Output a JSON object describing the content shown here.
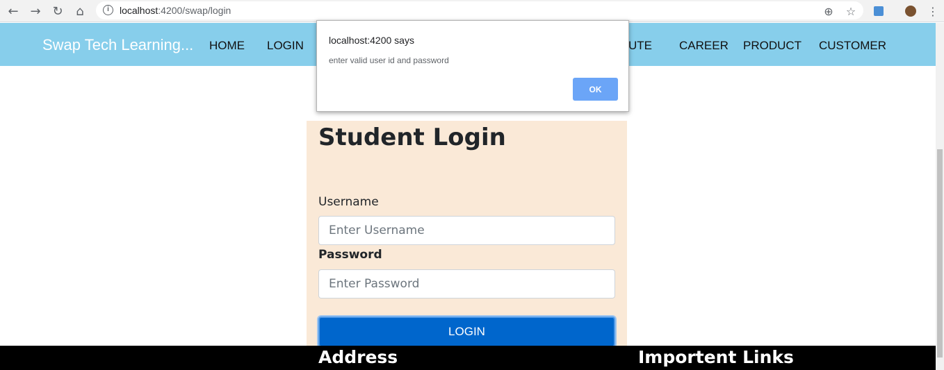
{
  "browser": {
    "url_host": "localhost",
    "url_rest": ":4200/swap/login"
  },
  "navbar": {
    "brand": "Swap Tech Learning...",
    "links": [
      "HOME",
      "LOGIN",
      "UTE",
      "CAREER",
      "PRODUCT",
      "CUSTOMER"
    ]
  },
  "login": {
    "title": "Student Login",
    "username_label": "Username",
    "username_placeholder": "Enter Username",
    "password_label": "Password",
    "password_placeholder": "Enter Password",
    "button": "LOGIN"
  },
  "footer": {
    "col1": "Address",
    "col2": "Importent Links"
  },
  "alert": {
    "title": "localhost:4200 says",
    "message": "enter valid user id and password",
    "ok": "OK"
  },
  "colors": {
    "navbar": "#87ceeb",
    "panel": "#fae9d7",
    "button": "#0066cc",
    "footer": "#000000"
  }
}
